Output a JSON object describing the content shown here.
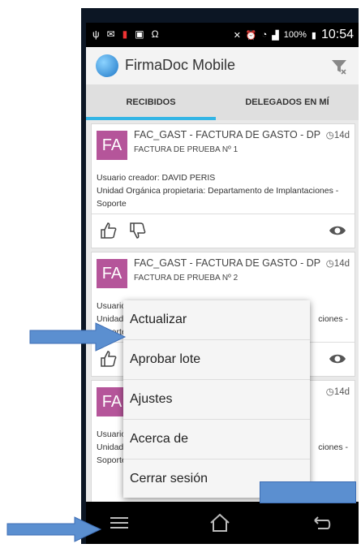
{
  "statusbar": {
    "time": "10:54",
    "battery": "100%"
  },
  "app": {
    "title": "FirmaDoc Mobile"
  },
  "tabs": [
    {
      "label": "RECIBIDOS"
    },
    {
      "label": "DELEGADOS EN MÍ"
    }
  ],
  "cards": [
    {
      "avatar": "FA",
      "title": "FAC_GAST - FACTURA DE GASTO - DP",
      "subtitle": "FACTURA DE PRUEBA Nº 1",
      "age": "14d",
      "creator": "Usuario creador: DAVID PERIS",
      "org_line1": "Unidad Orgánica propietaria: Departamento de Implantaciones -",
      "org_line2": "Soporte"
    },
    {
      "avatar": "FA",
      "title": "FAC_GAST - FACTURA DE GASTO - DP",
      "subtitle": "FACTURA DE PRUEBA Nº 2",
      "age": "14d",
      "creator": "Usuario creador: DAVID PERIS",
      "org_left": "Unidad",
      "org_right": "ciones -",
      "org_line2": "Soporte"
    },
    {
      "avatar": "FA",
      "age": "14d",
      "creator": "Usuario",
      "org_left": "Unidad",
      "org_right": "ciones -",
      "org_line2": "Soporte"
    }
  ],
  "menu": {
    "items": [
      {
        "label": "Actualizar"
      },
      {
        "label": "Aprobar lote"
      },
      {
        "label": "Ajustes"
      },
      {
        "label": "Acerca de"
      },
      {
        "label": "Cerrar sesión"
      }
    ]
  },
  "colors": {
    "accent": "#33b5e5",
    "avatar": "#b5559a",
    "arrow": "#5b8fd0"
  }
}
